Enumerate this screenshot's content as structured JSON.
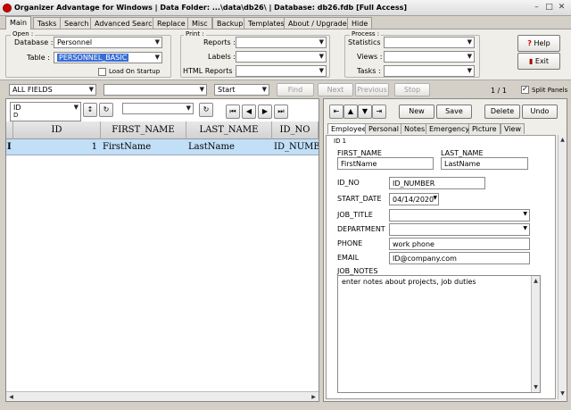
{
  "window": {
    "title": "Organizer Advantage for Windows | Data Folder: ...\\data\\db26\\ | Database: db26.fdb [Full Access]",
    "minimize": "–",
    "maximize": "□",
    "close": "✕"
  },
  "tabs": [
    "Main",
    "Tasks",
    "Search",
    "Advanced Search",
    "Replace",
    "Misc",
    "Backup",
    "Templates",
    "About / Upgrade",
    "Hide"
  ],
  "open_group": {
    "title": "Open :",
    "database_label": "Database :",
    "database_value": "Personnel",
    "table_label": "Table :",
    "table_value": "PERSONNEL_BASIC",
    "load_on_startup": "Load On Startup"
  },
  "print_group": {
    "title": "Print :",
    "reports_label": "Reports :",
    "labels_label": "Labels :",
    "html_reports_label": "HTML Reports :"
  },
  "process_group": {
    "title": "Process :",
    "statistics_label": "Statistics :",
    "views_label": "Views :",
    "tasks_label": "Tasks :"
  },
  "help_button": "Help",
  "exit_button": "Exit",
  "search_bar": {
    "field_value": "ALL FIELDS",
    "search_value": "",
    "position_value": "Start",
    "find": "Find",
    "next": "Next",
    "previous": "Previous",
    "stop": "Stop",
    "record_count": "1 / 1",
    "split_panels": "Split Panels"
  },
  "grid_toolbar": {
    "sort_field": "ID",
    "sort_sub": "D",
    "sort_dir_icon": "↕",
    "refresh_icon": "↻"
  },
  "grid": {
    "columns": [
      "ID",
      "FIRST_NAME",
      "LAST_NAME",
      "ID_NO"
    ],
    "rows": [
      {
        "indicator": "I",
        "id": "1",
        "first_name": "FirstName",
        "last_name": "LastName",
        "id_no": "ID_NUMBER"
      }
    ]
  },
  "record_toolbar": {
    "new": "New",
    "save": "Save",
    "delete": "Delete",
    "undo": "Undo"
  },
  "form_tabs": [
    "Employee",
    "Personal",
    "Notes",
    "Emergency",
    "Picture",
    "View"
  ],
  "form": {
    "id_label": "ID 1",
    "first_name_label": "FIRST_NAME",
    "first_name": "FirstName",
    "last_name_label": "LAST_NAME",
    "last_name": "LastName",
    "id_no_label": "ID_NO",
    "id_no": "ID_NUMBER",
    "start_date_label": "START_DATE",
    "start_date": "04/14/2020",
    "job_title_label": "JOB_TITLE",
    "job_title": "",
    "department_label": "DEPARTMENT",
    "department": "",
    "phone_label": "PHONE",
    "phone": "work phone",
    "email_label": "EMAIL",
    "email": "ID@company.com",
    "job_notes_label": "JOB_NOTES",
    "job_notes": "enter notes about projects, job duties"
  }
}
